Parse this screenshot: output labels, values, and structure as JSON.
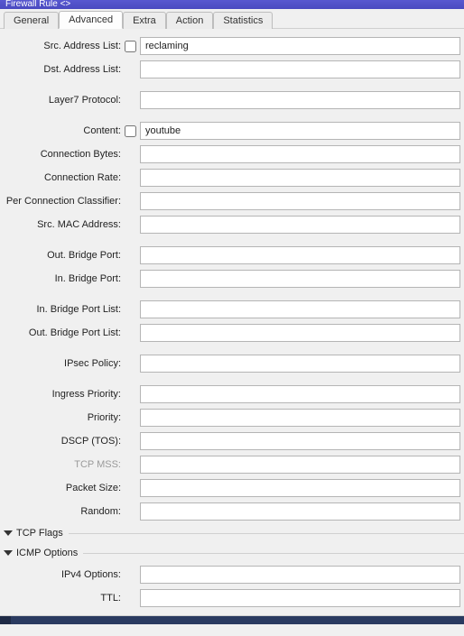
{
  "window": {
    "title": "Firewall Rule <>"
  },
  "tabs": {
    "general": "General",
    "advanced": "Advanced",
    "extra": "Extra",
    "action": "Action",
    "statistics": "Statistics",
    "active": "advanced"
  },
  "form": {
    "src_address_list": {
      "label": "Src. Address List:",
      "value": "reclaming"
    },
    "dst_address_list": {
      "label": "Dst. Address List:",
      "value": ""
    },
    "layer7_protocol": {
      "label": "Layer7 Protocol:",
      "value": ""
    },
    "content": {
      "label": "Content:",
      "value": "youtube"
    },
    "connection_bytes": {
      "label": "Connection Bytes:",
      "value": ""
    },
    "connection_rate": {
      "label": "Connection Rate:",
      "value": ""
    },
    "per_connection_classifier": {
      "label": "Per Connection Classifier:",
      "value": ""
    },
    "src_mac_address": {
      "label": "Src. MAC Address:",
      "value": ""
    },
    "out_bridge_port": {
      "label": "Out. Bridge Port:",
      "value": ""
    },
    "in_bridge_port": {
      "label": "In. Bridge Port:",
      "value": ""
    },
    "in_bridge_port_list": {
      "label": "In. Bridge Port List:",
      "value": ""
    },
    "out_bridge_port_list": {
      "label": "Out. Bridge Port List:",
      "value": ""
    },
    "ipsec_policy": {
      "label": "IPsec Policy:",
      "value": ""
    },
    "ingress_priority": {
      "label": "Ingress Priority:",
      "value": ""
    },
    "priority": {
      "label": "Priority:",
      "value": ""
    },
    "dscp_tos": {
      "label": "DSCP (TOS):",
      "value": ""
    },
    "tcp_mss": {
      "label": "TCP MSS:",
      "value": ""
    },
    "packet_size": {
      "label": "Packet Size:",
      "value": ""
    },
    "random": {
      "label": "Random:",
      "value": ""
    },
    "ipv4_options": {
      "label": "IPv4 Options:",
      "value": ""
    },
    "ttl": {
      "label": "TTL:",
      "value": ""
    }
  },
  "sections": {
    "tcp_flags": "TCP Flags",
    "icmp_options": "ICMP Options"
  }
}
